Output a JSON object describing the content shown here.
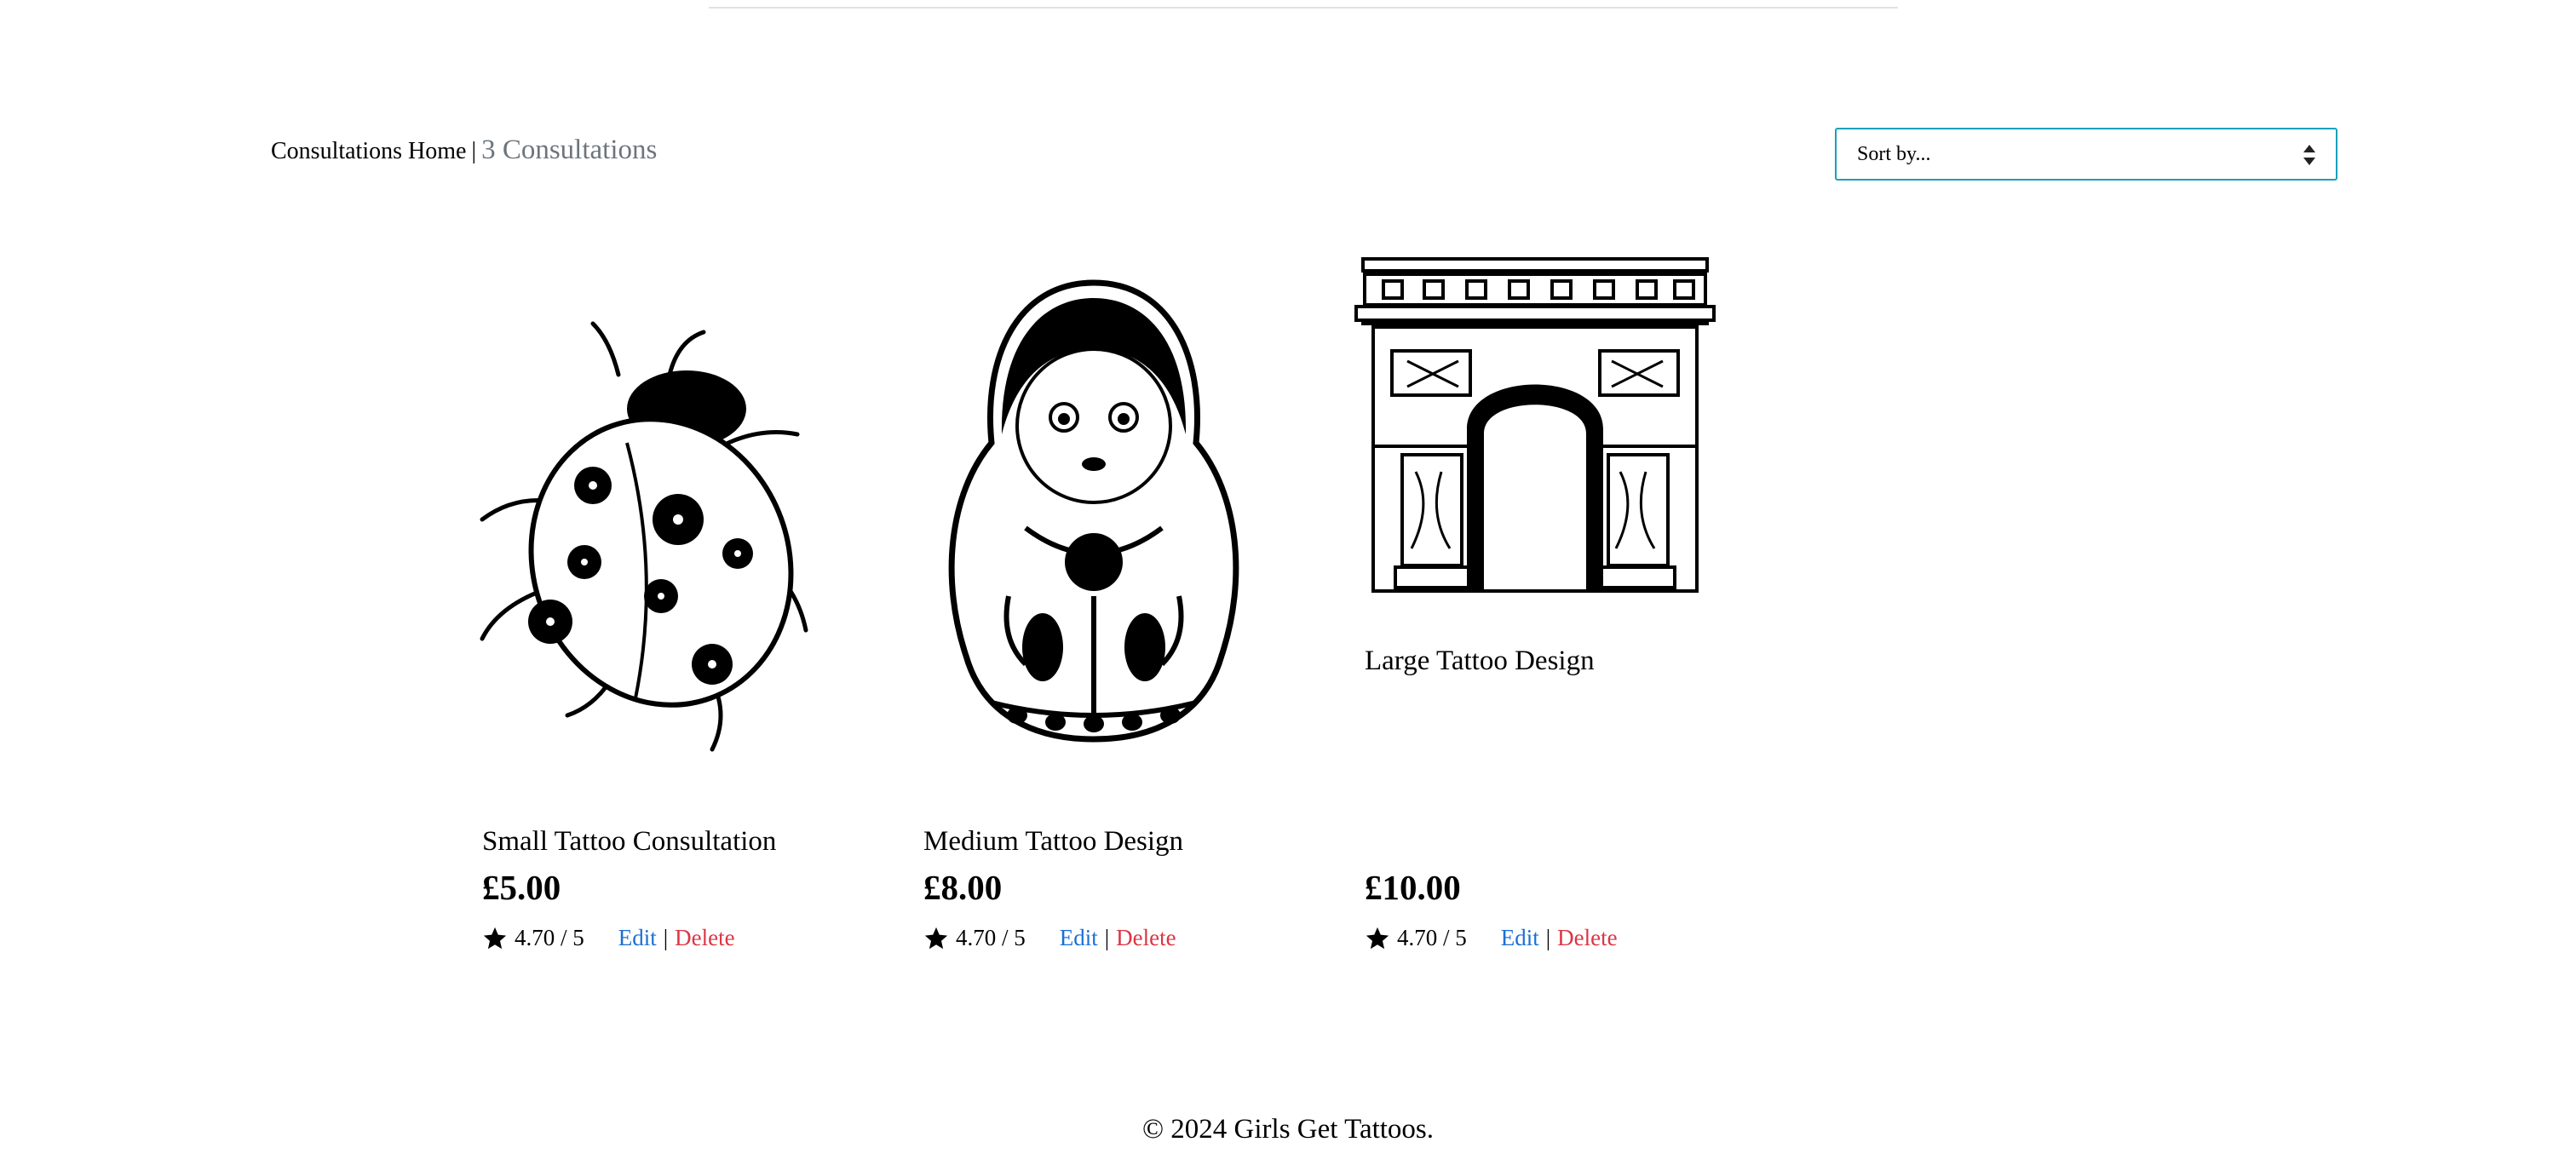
{
  "breadcrumb": {
    "home": "Consultations Home",
    "separator": "|",
    "count": "3 Consultations"
  },
  "sort": {
    "selected": "Sort by..."
  },
  "products": [
    {
      "title": "Small Tattoo Consultation",
      "price": "£5.00",
      "rating": "4.70 / 5",
      "edit": "Edit",
      "separator": "|",
      "delete": "Delete",
      "image_icon": "ladybug-illustration"
    },
    {
      "title": "Medium Tattoo Design",
      "price": "£8.00",
      "rating": "4.70 / 5",
      "edit": "Edit",
      "separator": "|",
      "delete": "Delete",
      "image_icon": "matryoshka-doll-illustration"
    },
    {
      "title": "Large Tattoo Design",
      "price": "£10.00",
      "rating": "4.70 / 5",
      "edit": "Edit",
      "separator": "|",
      "delete": "Delete",
      "image_icon": "arc-de-triomphe-illustration"
    }
  ],
  "footer": {
    "text": "© 2024 Girls Get Tattoos."
  },
  "colors": {
    "accent_border": "#17a2b8",
    "muted_text": "#6c757d",
    "edit_link": "#1a6fd4",
    "delete_link": "#dc3545"
  }
}
